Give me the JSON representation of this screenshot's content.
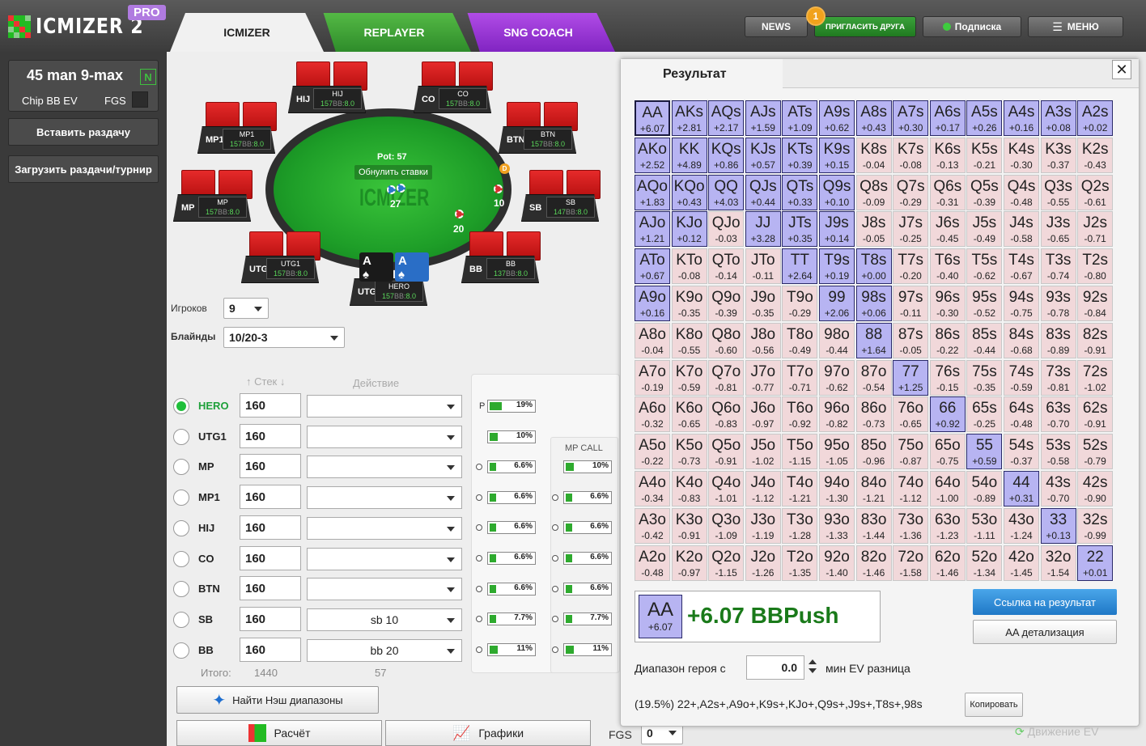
{
  "app": {
    "logo_text": "ICMIZER 2",
    "logo_badge": "PRO"
  },
  "tabs": [
    {
      "label": "ICMIZER"
    },
    {
      "label": "REPLAYER"
    },
    {
      "label": "SNG COACH"
    }
  ],
  "topbar": {
    "news": "NEWS",
    "invite": "ПРИГЛАСИТЬ ДРУГА",
    "invite_badge": "1",
    "subscription": "Подписка",
    "menu": "МЕНЮ"
  },
  "sidebar": {
    "game_title": "45 man 9-max",
    "game_badge": "N",
    "chip_ev": "Chip BB EV",
    "fgs": "FGS",
    "paste_hand": "Вставить раздачу",
    "load_hands": "Загрузить раздачи/турнир"
  },
  "table": {
    "pot": "Pot: 57",
    "reset_bets": "Обнулить ставки",
    "watermark": "ICMIZER",
    "dealer": "D",
    "bets": {
      "left": "27",
      "right": "10",
      "bottom": "20"
    },
    "hero_cards": [
      {
        "rank": "A",
        "suit": "♠"
      },
      {
        "rank": "A",
        "suit": "♠"
      }
    ],
    "seats": [
      {
        "pos": "HIJ",
        "name": "HIJ",
        "stack_bb": "157",
        "stack_unit": "BB",
        "stack_rest": ":8.0"
      },
      {
        "pos": "CO",
        "name": "CO",
        "stack_bb": "157",
        "stack_unit": "BB",
        "stack_rest": ":8.0"
      },
      {
        "pos": "MP1",
        "name": "MP1",
        "stack_bb": "157",
        "stack_unit": "BB",
        "stack_rest": ":8.0"
      },
      {
        "pos": "BTN",
        "name": "BTN",
        "stack_bb": "157",
        "stack_unit": "BB",
        "stack_rest": ":8.0"
      },
      {
        "pos": "MP",
        "name": "MP",
        "stack_bb": "157",
        "stack_unit": "BB",
        "stack_rest": ":8.0"
      },
      {
        "pos": "SB",
        "name": "SB",
        "stack_bb": "147",
        "stack_unit": "BB",
        "stack_rest": ":8.0"
      },
      {
        "pos": "UTG1",
        "name": "UTG1",
        "stack_bb": "157",
        "stack_unit": "BB",
        "stack_rest": ":8.0"
      },
      {
        "pos": "BB",
        "name": "BB",
        "stack_bb": "137",
        "stack_unit": "BB",
        "stack_rest": ":8.0"
      },
      {
        "pos": "UTG",
        "name": "HERO",
        "stack_bb": "157",
        "stack_unit": "BB",
        "stack_rest": ":8.0"
      }
    ]
  },
  "settings": {
    "players_label": "Игроков",
    "players_value": "9",
    "blinds_label": "Блайнды",
    "blinds_value": "10/20-3",
    "col_stack": "Стек",
    "col_action": "Действие"
  },
  "players": [
    {
      "name": "HERO",
      "stack": "160",
      "action": "",
      "selected": true
    },
    {
      "name": "UTG1",
      "stack": "160",
      "action": ""
    },
    {
      "name": "MP",
      "stack": "160",
      "action": ""
    },
    {
      "name": "MP1",
      "stack": "160",
      "action": ""
    },
    {
      "name": "HIJ",
      "stack": "160",
      "action": ""
    },
    {
      "name": "CO",
      "stack": "160",
      "action": ""
    },
    {
      "name": "BTN",
      "stack": "160",
      "action": ""
    },
    {
      "name": "SB",
      "stack": "160",
      "action": "sb 10"
    },
    {
      "name": "BB",
      "stack": "160",
      "action": "bb 20"
    }
  ],
  "totals": {
    "label": "Итого:",
    "stack": "1440",
    "action": "57"
  },
  "push_ranges": {
    "p_label": "P",
    "col1": [
      {
        "text": "19%",
        "pct": 19
      },
      {
        "text": "10%",
        "pct": 10
      },
      {
        "text": "6.6%",
        "pct": 6.6
      },
      {
        "text": "6.6%",
        "pct": 6.6
      },
      {
        "text": "6.6%",
        "pct": 6.6
      },
      {
        "text": "6.6%",
        "pct": 6.6
      },
      {
        "text": "6.6%",
        "pct": 6.6
      },
      {
        "text": "7.7%",
        "pct": 7.7
      },
      {
        "text": "11%",
        "pct": 11
      }
    ],
    "mp_call_label": "MP CALL",
    "col2": [
      {
        "text": "10%",
        "pct": 10
      },
      {
        "text": "6.6%",
        "pct": 6.6
      },
      {
        "text": "6.6%",
        "pct": 6.6
      },
      {
        "text": "6.6%",
        "pct": 6.6
      },
      {
        "text": "6.6%",
        "pct": 6.6
      },
      {
        "text": "7.7%",
        "pct": 7.7
      },
      {
        "text": "11%",
        "pct": 11
      }
    ]
  },
  "buttons": {
    "nash": "Найти Нэш диапазоны",
    "calc": "Расчёт",
    "graphs": "Графики",
    "fgs": "FGS",
    "fgs_value": "0"
  },
  "result": {
    "title": "Результат",
    "close": "✕",
    "grid": [
      [
        [
          "AA",
          "+6.07"
        ],
        [
          "AKs",
          "+2.81"
        ],
        [
          "AQs",
          "+2.17"
        ],
        [
          "AJs",
          "+1.59"
        ],
        [
          "ATs",
          "+1.09"
        ],
        [
          "A9s",
          "+0.62"
        ],
        [
          "A8s",
          "+0.43"
        ],
        [
          "A7s",
          "+0.30"
        ],
        [
          "A6s",
          "+0.17"
        ],
        [
          "A5s",
          "+0.26"
        ],
        [
          "A4s",
          "+0.16"
        ],
        [
          "A3s",
          "+0.08"
        ],
        [
          "A2s",
          "+0.02"
        ]
      ],
      [
        [
          "AKo",
          "+2.52"
        ],
        [
          "KK",
          "+4.89"
        ],
        [
          "KQs",
          "+0.86"
        ],
        [
          "KJs",
          "+0.57"
        ],
        [
          "KTs",
          "+0.39"
        ],
        [
          "K9s",
          "+0.15"
        ],
        [
          "K8s",
          "-0.04"
        ],
        [
          "K7s",
          "-0.08"
        ],
        [
          "K6s",
          "-0.13"
        ],
        [
          "K5s",
          "-0.21"
        ],
        [
          "K4s",
          "-0.30"
        ],
        [
          "K3s",
          "-0.37"
        ],
        [
          "K2s",
          "-0.43"
        ]
      ],
      [
        [
          "AQo",
          "+1.83"
        ],
        [
          "KQo",
          "+0.43"
        ],
        [
          "QQ",
          "+4.03"
        ],
        [
          "QJs",
          "+0.44"
        ],
        [
          "QTs",
          "+0.33"
        ],
        [
          "Q9s",
          "+0.10"
        ],
        [
          "Q8s",
          "-0.09"
        ],
        [
          "Q7s",
          "-0.29"
        ],
        [
          "Q6s",
          "-0.31"
        ],
        [
          "Q5s",
          "-0.39"
        ],
        [
          "Q4s",
          "-0.48"
        ],
        [
          "Q3s",
          "-0.55"
        ],
        [
          "Q2s",
          "-0.61"
        ]
      ],
      [
        [
          "AJo",
          "+1.21"
        ],
        [
          "KJo",
          "+0.12"
        ],
        [
          "QJo",
          "-0.03"
        ],
        [
          "JJ",
          "+3.28"
        ],
        [
          "JTs",
          "+0.35"
        ],
        [
          "J9s",
          "+0.14"
        ],
        [
          "J8s",
          "-0.05"
        ],
        [
          "J7s",
          "-0.25"
        ],
        [
          "J6s",
          "-0.45"
        ],
        [
          "J5s",
          "-0.49"
        ],
        [
          "J4s",
          "-0.58"
        ],
        [
          "J3s",
          "-0.65"
        ],
        [
          "J2s",
          "-0.71"
        ]
      ],
      [
        [
          "ATo",
          "+0.67"
        ],
        [
          "KTo",
          "-0.08"
        ],
        [
          "QTo",
          "-0.14"
        ],
        [
          "JTo",
          "-0.11"
        ],
        [
          "TT",
          "+2.64"
        ],
        [
          "T9s",
          "+0.19"
        ],
        [
          "T8s",
          "+0.00"
        ],
        [
          "T7s",
          "-0.20"
        ],
        [
          "T6s",
          "-0.40"
        ],
        [
          "T5s",
          "-0.62"
        ],
        [
          "T4s",
          "-0.67"
        ],
        [
          "T3s",
          "-0.74"
        ],
        [
          "T2s",
          "-0.80"
        ]
      ],
      [
        [
          "A9o",
          "+0.16"
        ],
        [
          "K9o",
          "-0.35"
        ],
        [
          "Q9o",
          "-0.39"
        ],
        [
          "J9o",
          "-0.35"
        ],
        [
          "T9o",
          "-0.29"
        ],
        [
          "99",
          "+2.06"
        ],
        [
          "98s",
          "+0.06"
        ],
        [
          "97s",
          "-0.11"
        ],
        [
          "96s",
          "-0.30"
        ],
        [
          "95s",
          "-0.52"
        ],
        [
          "94s",
          "-0.75"
        ],
        [
          "93s",
          "-0.78"
        ],
        [
          "92s",
          "-0.84"
        ]
      ],
      [
        [
          "A8o",
          "-0.04"
        ],
        [
          "K8o",
          "-0.55"
        ],
        [
          "Q8o",
          "-0.60"
        ],
        [
          "J8o",
          "-0.56"
        ],
        [
          "T8o",
          "-0.49"
        ],
        [
          "98o",
          "-0.44"
        ],
        [
          "88",
          "+1.64"
        ],
        [
          "87s",
          "-0.05"
        ],
        [
          "86s",
          "-0.22"
        ],
        [
          "85s",
          "-0.44"
        ],
        [
          "84s",
          "-0.68"
        ],
        [
          "83s",
          "-0.89"
        ],
        [
          "82s",
          "-0.91"
        ]
      ],
      [
        [
          "A7o",
          "-0.19"
        ],
        [
          "K7o",
          "-0.59"
        ],
        [
          "Q7o",
          "-0.81"
        ],
        [
          "J7o",
          "-0.77"
        ],
        [
          "T7o",
          "-0.71"
        ],
        [
          "97o",
          "-0.62"
        ],
        [
          "87o",
          "-0.54"
        ],
        [
          "77",
          "+1.25"
        ],
        [
          "76s",
          "-0.15"
        ],
        [
          "75s",
          "-0.35"
        ],
        [
          "74s",
          "-0.59"
        ],
        [
          "73s",
          "-0.81"
        ],
        [
          "72s",
          "-1.02"
        ]
      ],
      [
        [
          "A6o",
          "-0.32"
        ],
        [
          "K6o",
          "-0.65"
        ],
        [
          "Q6o",
          "-0.83"
        ],
        [
          "J6o",
          "-0.97"
        ],
        [
          "T6o",
          "-0.92"
        ],
        [
          "96o",
          "-0.82"
        ],
        [
          "86o",
          "-0.73"
        ],
        [
          "76o",
          "-0.65"
        ],
        [
          "66",
          "+0.92"
        ],
        [
          "65s",
          "-0.25"
        ],
        [
          "64s",
          "-0.48"
        ],
        [
          "63s",
          "-0.70"
        ],
        [
          "62s",
          "-0.91"
        ]
      ],
      [
        [
          "A5o",
          "-0.22"
        ],
        [
          "K5o",
          "-0.73"
        ],
        [
          "Q5o",
          "-0.91"
        ],
        [
          "J5o",
          "-1.02"
        ],
        [
          "T5o",
          "-1.15"
        ],
        [
          "95o",
          "-1.05"
        ],
        [
          "85o",
          "-0.96"
        ],
        [
          "75o",
          "-0.87"
        ],
        [
          "65o",
          "-0.75"
        ],
        [
          "55",
          "+0.59"
        ],
        [
          "54s",
          "-0.37"
        ],
        [
          "53s",
          "-0.58"
        ],
        [
          "52s",
          "-0.79"
        ]
      ],
      [
        [
          "A4o",
          "-0.34"
        ],
        [
          "K4o",
          "-0.83"
        ],
        [
          "Q4o",
          "-1.01"
        ],
        [
          "J4o",
          "-1.12"
        ],
        [
          "T4o",
          "-1.21"
        ],
        [
          "94o",
          "-1.30"
        ],
        [
          "84o",
          "-1.21"
        ],
        [
          "74o",
          "-1.12"
        ],
        [
          "64o",
          "-1.00"
        ],
        [
          "54o",
          "-0.89"
        ],
        [
          "44",
          "+0.31"
        ],
        [
          "43s",
          "-0.70"
        ],
        [
          "42s",
          "-0.90"
        ]
      ],
      [
        [
          "A3o",
          "-0.42"
        ],
        [
          "K3o",
          "-0.91"
        ],
        [
          "Q3o",
          "-1.09"
        ],
        [
          "J3o",
          "-1.19"
        ],
        [
          "T3o",
          "-1.28"
        ],
        [
          "93o",
          "-1.33"
        ],
        [
          "83o",
          "-1.44"
        ],
        [
          "73o",
          "-1.36"
        ],
        [
          "63o",
          "-1.23"
        ],
        [
          "53o",
          "-1.11"
        ],
        [
          "43o",
          "-1.24"
        ],
        [
          "33",
          "+0.13"
        ],
        [
          "32s",
          "-0.99"
        ]
      ],
      [
        [
          "A2o",
          "-0.48"
        ],
        [
          "K2o",
          "-0.97"
        ],
        [
          "Q2o",
          "-1.15"
        ],
        [
          "J2o",
          "-1.26"
        ],
        [
          "T2o",
          "-1.35"
        ],
        [
          "92o",
          "-1.40"
        ],
        [
          "82o",
          "-1.46"
        ],
        [
          "72o",
          "-1.58"
        ],
        [
          "62o",
          "-1.46"
        ],
        [
          "52o",
          "-1.34"
        ],
        [
          "42o",
          "-1.45"
        ],
        [
          "32o",
          "-1.54"
        ],
        [
          "22",
          "+0.01"
        ]
      ]
    ],
    "push_hands": [
      "AA",
      "AKs",
      "AQs",
      "AJs",
      "ATs",
      "A9s",
      "A8s",
      "A7s",
      "A6s",
      "A5s",
      "A4s",
      "A3s",
      "A2s",
      "AKo",
      "KK",
      "KQs",
      "KJs",
      "KTs",
      "K9s",
      "AQo",
      "KQo",
      "QQ",
      "QJs",
      "QTs",
      "Q9s",
      "AJo",
      "KJo",
      "JJ",
      "JTs",
      "J9s",
      "ATo",
      "TT",
      "T9s",
      "T8s",
      "A9o",
      "99",
      "98s",
      "88",
      "77",
      "66",
      "55",
      "44",
      "33",
      "22"
    ],
    "selected_hand": {
      "name": "AA",
      "ev": "+6.07",
      "big_text": "+6.07 BBPush"
    },
    "link_button": "Ссылка на результат",
    "detail_button": "AA детализация",
    "range_label": "Диапазон героя с",
    "min_ev_value": "0.0",
    "min_ev_label": "мин EV разница",
    "range_string": "(19.5%) 22+,A2s+,A9o+,K9s+,KJo+,Q9s+,J9s+,T8s+,98s",
    "copy_button": "Копировать",
    "ev_move": "Движение EV"
  },
  "colors": {
    "push": "#b7b4f2",
    "fold": "#f1d8da",
    "accent_green": "#1a7a1a",
    "link_blue": "#1f78c6"
  }
}
